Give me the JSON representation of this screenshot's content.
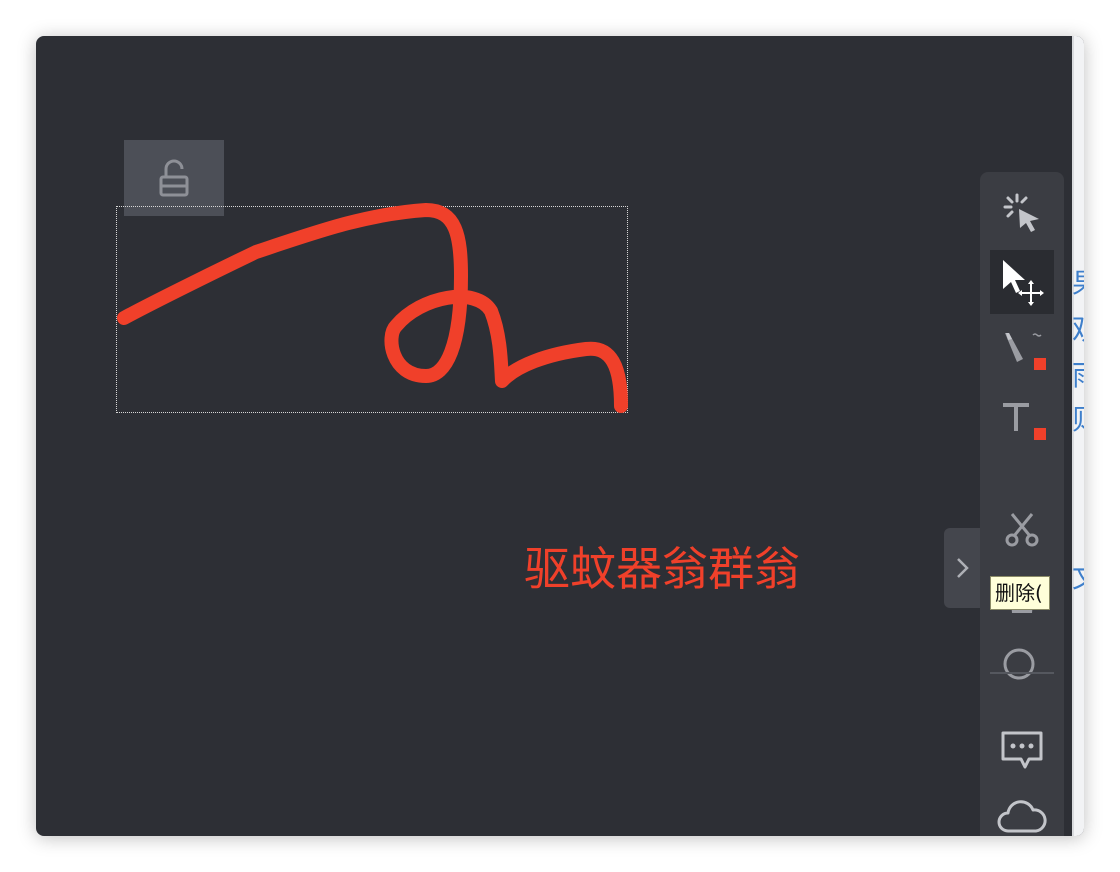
{
  "canvas": {
    "annotation_text": "驱蚊器翁群翁",
    "stroke_color": "#f0402a",
    "background_color": "#2d2f35"
  },
  "lock": {
    "icon": "unlock-icon"
  },
  "collapse": {
    "icon": "chevron-right-icon"
  },
  "toolbar": {
    "tools": [
      {
        "name": "laser-pointer",
        "icon": "laser-pointer-icon",
        "active": false
      },
      {
        "name": "select-move",
        "icon": "select-move-icon",
        "active": true
      },
      {
        "name": "pen",
        "icon": "pen-icon",
        "color": "#f0402a",
        "active": false
      },
      {
        "name": "text",
        "icon": "text-icon",
        "color": "#f0402a",
        "active": false
      },
      {
        "name": "cut",
        "icon": "scissors-icon",
        "active": false
      },
      {
        "name": "delete",
        "icon": "trash-icon",
        "active": false
      },
      {
        "name": "shape",
        "icon": "circle-icon",
        "active": false
      },
      {
        "name": "comment",
        "icon": "comment-icon",
        "active": false
      },
      {
        "name": "cloud",
        "icon": "cloud-icon",
        "active": false
      }
    ],
    "tooltip": "删除("
  },
  "background_page": {
    "visible_chars": [
      "果",
      "观",
      "雨",
      "则",
      "文"
    ],
    "link_color": "#3e7fcb"
  }
}
